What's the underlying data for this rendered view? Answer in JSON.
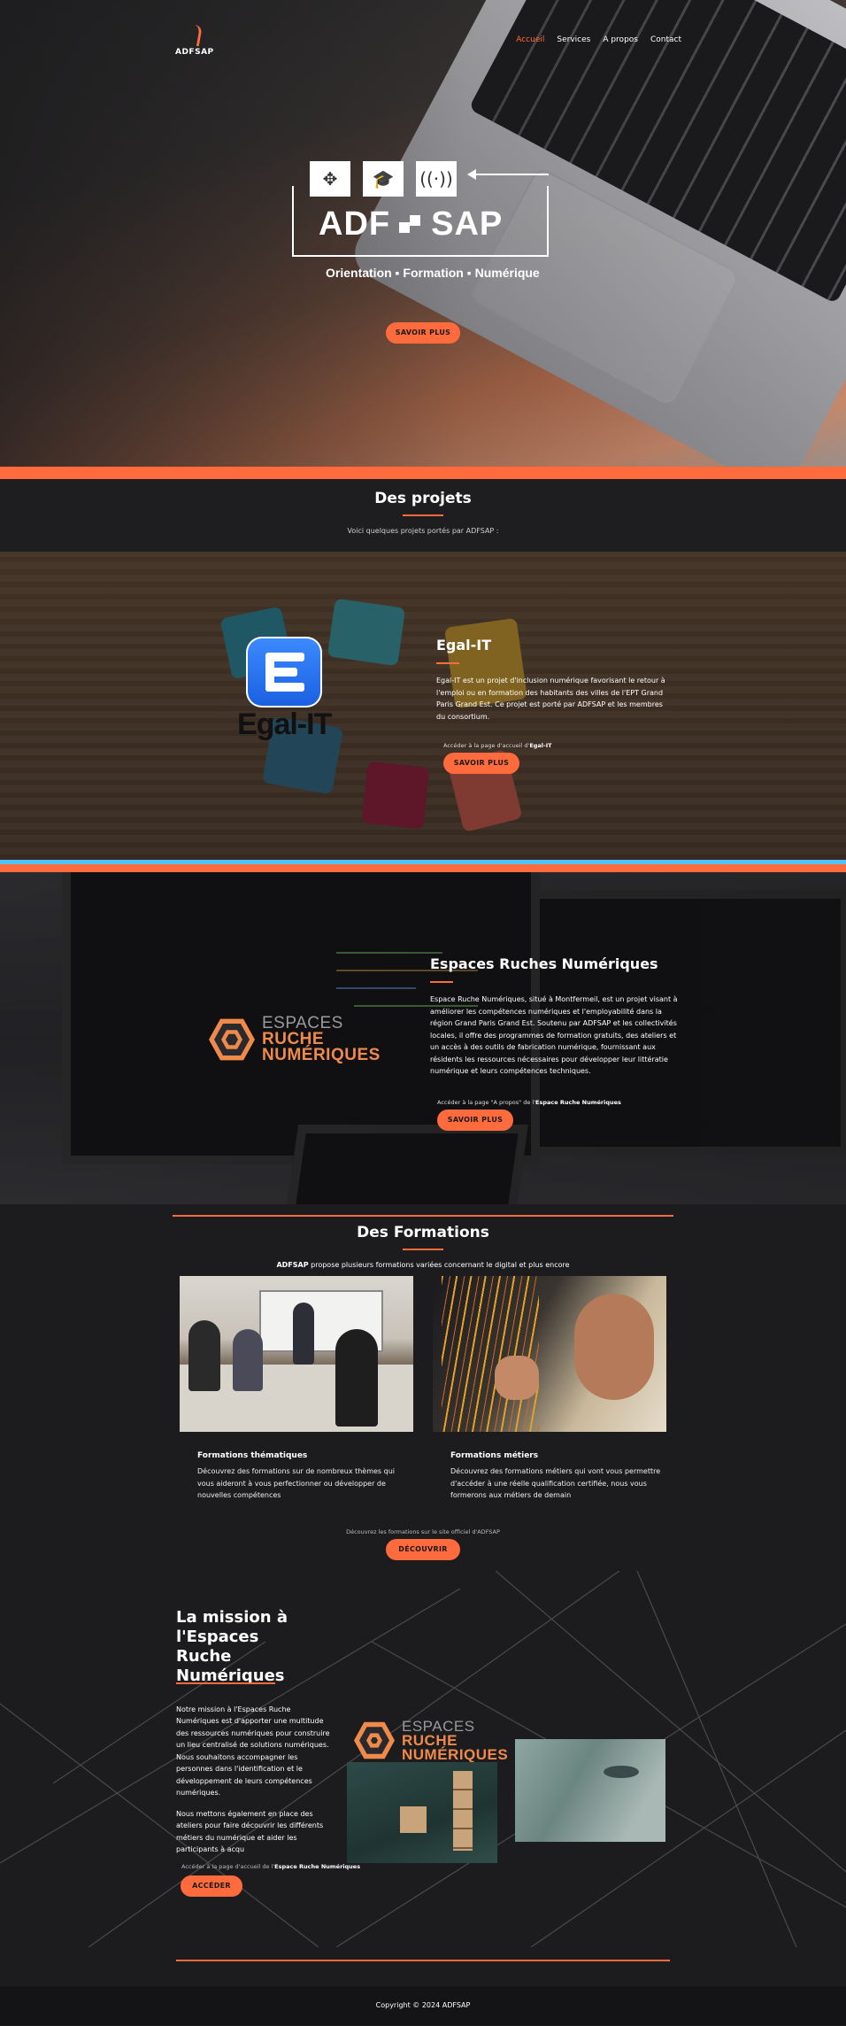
{
  "brand": {
    "name": "ADFSAP"
  },
  "nav": {
    "items": [
      {
        "label": "Accueil"
      },
      {
        "label": "Services"
      },
      {
        "label": "A propos"
      },
      {
        "label": "Contact"
      }
    ]
  },
  "hero": {
    "logo_left": "ADF",
    "logo_right": "SAP",
    "tagline": "Orientation ▪ Formation ▪ Numérique",
    "button": "SAVOIR PLUS",
    "icons": [
      "arrows-icon",
      "graduation-cap-icon",
      "wifi-icon"
    ]
  },
  "projects": {
    "title": "Des projets",
    "subtitle": "Voici quelques projets portés par ADFSAP :",
    "egal": {
      "logo_text": "Egal-IT",
      "title": "Egal-IT",
      "description": "Egal-IT est un projet d'inclusion numérique favorisant le retour à l'emploi ou en formation des habitants des villes de l'EPT Grand Paris Grand Est. Ce projet est porté par ADFSAP et les membres du consortium.",
      "link_note_prefix": "Accéder à la page d'accueil d'",
      "link_note_target": "Egal-IT",
      "button": "SAVOIR PLUS"
    },
    "ruche": {
      "logo_w1": "ESPACES",
      "logo_w2": "RUCHE",
      "logo_w3": "NUMÉRIQUES",
      "title": "Espaces Ruches Numériques",
      "description": "Espace Ruche Numériques, situé à Montfermeil, est un projet visant à améliorer les compétences numériques et l'employabilité dans la région Grand Paris Grand Est. Soutenu par ADFSAP et les collectivités locales, il offre des programmes de formation gratuits, des ateliers et un accès à des outils de fabrication numérique, fournissant aux résidents les ressources nécessaires pour développer leur littératie numérique et leurs compétences techniques.",
      "link_note_prefix": "Accéder à la page \"A propos\" de l'",
      "link_note_target": "Espace Ruche Numériques",
      "button": "SAVOIR PLUS"
    }
  },
  "formations": {
    "title": "Des Formations",
    "intro_bold": "ADFSAP",
    "intro_rest": " propose plusieurs formations variées concernant le digital et plus encore",
    "cards": [
      {
        "title": "Formations thématiques",
        "text": "Découvrez des formations sur de nombreux thèmes qui vous aideront à vous perfectionner ou développer de nouvelles compétences"
      },
      {
        "title": "Formations métiers",
        "text": "Découvrez des formations métiers qui vont vous permettre d'accéder à une réelle qualification certifiée, nous vous formerons aux métiers de demain"
      }
    ],
    "note": "Découvrez les formations sur le site officiel d'ADFSAP",
    "button": "DÉCOUVRIR"
  },
  "mission": {
    "title": "La mission à l'Espaces Ruche Numériques",
    "p1": "Notre mission à l'Espaces Ruche Numériques est d'apporter une multitude des ressources numériques pour construire un lieu centralisé de solutions numériques. Nous souhaitons accompagner les personnes dans l'identification et le développement de leurs compétences numériques.",
    "p2": "Nous mettons également en place des ateliers pour faire découvrir les différents métiers du numérique et aider les participants à acqu",
    "note_prefix": "Accéder à la page d'accueil de l'",
    "note_target": "Espace Ruche Numériques",
    "button": "ACCÉDER"
  },
  "footer": {
    "copyright": "Copyright © 2024 ADFSAP"
  },
  "colors": {
    "accent": "#ff6b3d",
    "background": "#1c1c1e",
    "blue_bar": "#4fc3f7"
  }
}
